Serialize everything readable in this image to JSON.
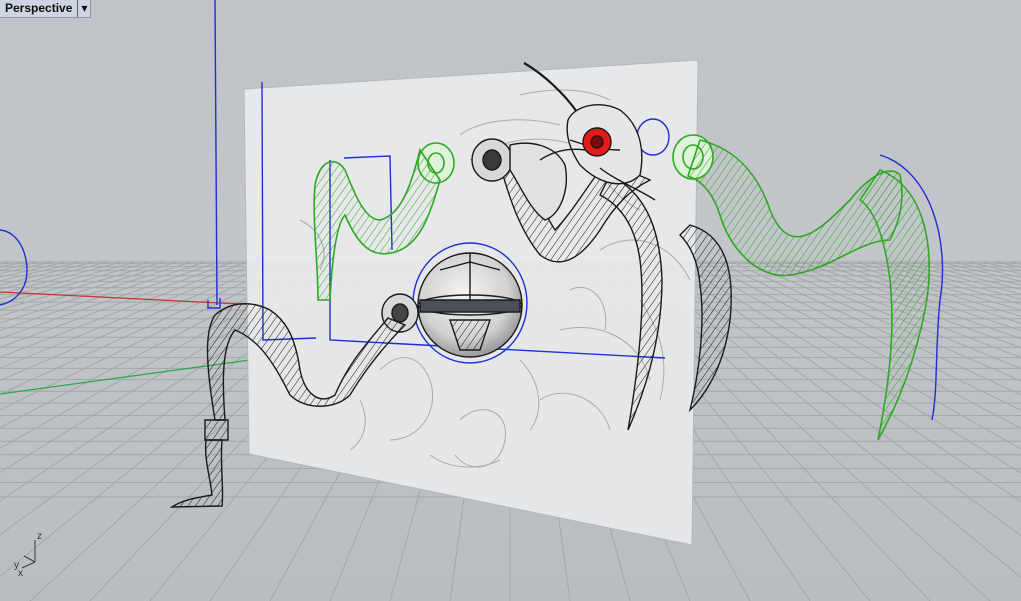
{
  "viewport": {
    "name": "Perspective",
    "menu_icon": "chevron-down-icon",
    "background": "#c0c3c8",
    "grid_color": "#a3a6ab",
    "axes": {
      "x_color": "#c0392b",
      "y_color": "#27a84a",
      "z_color": "#1f2fd0"
    }
  },
  "axis_triad": {
    "z": "z",
    "y": "y",
    "x": "x"
  },
  "model": {
    "wireframe_color": "#1a1a1a",
    "selected_color": "#2fa823",
    "curve_color": "#1f2fd0",
    "eye_color": "#e21a1a"
  }
}
